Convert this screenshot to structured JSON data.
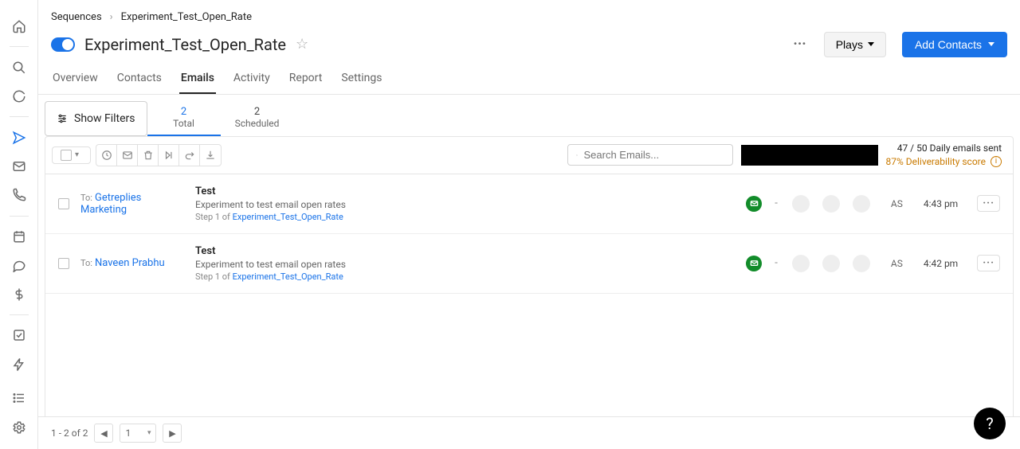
{
  "breadcrumb": {
    "root": "Sequences",
    "current": "Experiment_Test_Open_Rate"
  },
  "page_title": "Experiment_Test_Open_Rate",
  "header_buttons": {
    "plays": "Plays",
    "add_contacts": "Add Contacts"
  },
  "tabs": [
    "Overview",
    "Contacts",
    "Emails",
    "Activity",
    "Report",
    "Settings"
  ],
  "active_tab_index": 2,
  "filters": {
    "show_filters_label": "Show Filters",
    "tiles": [
      {
        "count": "2",
        "label": "Total"
      },
      {
        "count": "2",
        "label": "Scheduled"
      }
    ],
    "active_tile_index": 0
  },
  "search": {
    "placeholder": "Search Emails..."
  },
  "stats": {
    "line1": "47 / 50 Daily emails sent",
    "line2": "87% Deliverability score"
  },
  "to_label": "To:",
  "step_prefix": "Step 1 of",
  "emails": [
    {
      "recipient": "Getreplies Marketing",
      "subject": "Test",
      "preview": "Experiment to test email open rates",
      "sequence": "Experiment_Test_Open_Rate",
      "owner": "AS",
      "time": "4:43 pm"
    },
    {
      "recipient": "Naveen Prabhu",
      "subject": "Test",
      "preview": "Experiment to test email open rates",
      "sequence": "Experiment_Test_Open_Rate",
      "owner": "AS",
      "time": "4:42 pm"
    }
  ],
  "pagination": {
    "range": "1 - 2 of 2",
    "page": "1"
  }
}
